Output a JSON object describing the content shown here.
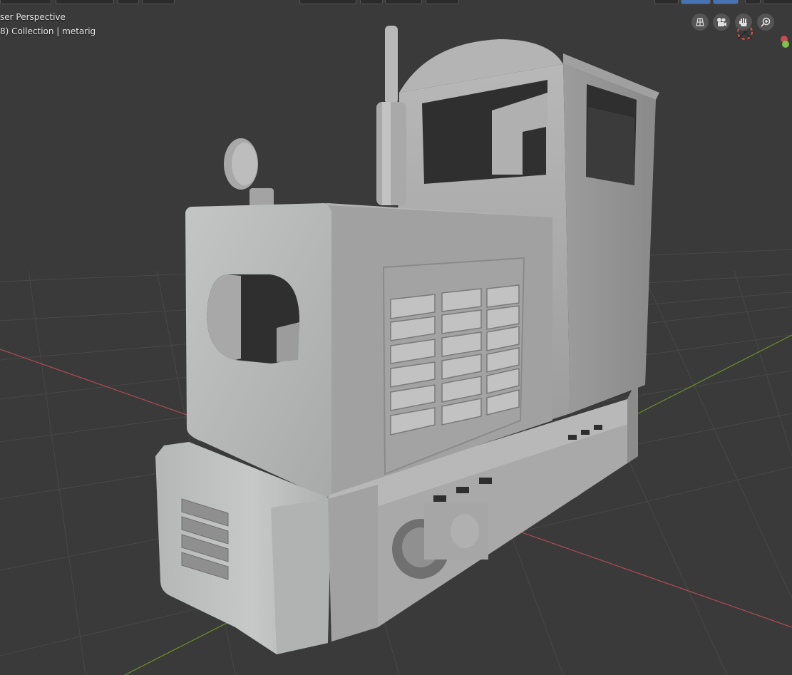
{
  "viewport": {
    "view_name": "ser Perspective",
    "view_info": "8) Collection | metarig"
  },
  "navigation_gizmo": {
    "buttons": [
      {
        "icon": "ortho-grid-icon"
      },
      {
        "icon": "camera-icon"
      },
      {
        "icon": "hand-pan-icon"
      },
      {
        "icon": "zoom-icon"
      }
    ]
  },
  "colors": {
    "background": "#3a3a3a",
    "grid": "#484848",
    "x_axis": "#b24a55",
    "y_axis": "#6f8f2c",
    "model_light": "#c9c9c9",
    "model_mid": "#a5a5a5",
    "model_dark": "#7d7d7d"
  }
}
